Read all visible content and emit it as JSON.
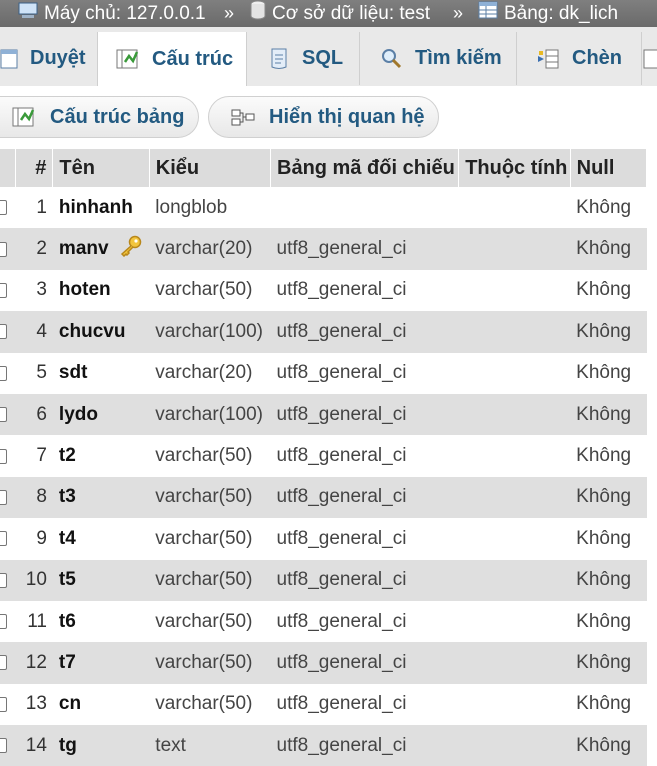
{
  "breadcrumb": {
    "server": "Máy chủ: 127.0.0.1",
    "database": "Cơ sở dữ liệu: test",
    "table": "Bảng: dk_lich",
    "separator": "»"
  },
  "tabs": [
    {
      "label": "Duyệt",
      "icon": "browse-icon"
    },
    {
      "label": "Cấu trúc",
      "icon": "structure-icon",
      "active": true
    },
    {
      "label": "SQL",
      "icon": "sql-icon"
    },
    {
      "label": "Tìm kiếm",
      "icon": "search-icon"
    },
    {
      "label": "Chèn",
      "icon": "insert-icon"
    }
  ],
  "subnav": {
    "structure_label": "Cấu trúc bảng",
    "relation_label": "Hiển thị quan hệ"
  },
  "table": {
    "headers": {
      "num": "#",
      "name": "Tên",
      "type": "Kiểu",
      "collation": "Bảng mã đối chiếu",
      "attributes": "Thuộc tính",
      "null": "Null"
    },
    "rows": [
      {
        "num": "1",
        "name": "hinhanh",
        "type": "longblob",
        "collation": "",
        "null": "Không"
      },
      {
        "num": "2",
        "name": "manv",
        "type": "varchar(20)",
        "collation": "utf8_general_ci",
        "null": "Không",
        "primary_key": true
      },
      {
        "num": "3",
        "name": "hoten",
        "type": "varchar(50)",
        "collation": "utf8_general_ci",
        "null": "Không"
      },
      {
        "num": "4",
        "name": "chucvu",
        "type": "varchar(100)",
        "collation": "utf8_general_ci",
        "null": "Không"
      },
      {
        "num": "5",
        "name": "sdt",
        "type": "varchar(20)",
        "collation": "utf8_general_ci",
        "null": "Không"
      },
      {
        "num": "6",
        "name": "lydo",
        "type": "varchar(100)",
        "collation": "utf8_general_ci",
        "null": "Không"
      },
      {
        "num": "7",
        "name": "t2",
        "type": "varchar(50)",
        "collation": "utf8_general_ci",
        "null": "Không"
      },
      {
        "num": "8",
        "name": "t3",
        "type": "varchar(50)",
        "collation": "utf8_general_ci",
        "null": "Không"
      },
      {
        "num": "9",
        "name": "t4",
        "type": "varchar(50)",
        "collation": "utf8_general_ci",
        "null": "Không"
      },
      {
        "num": "10",
        "name": "t5",
        "type": "varchar(50)",
        "collation": "utf8_general_ci",
        "null": "Không"
      },
      {
        "num": "11",
        "name": "t6",
        "type": "varchar(50)",
        "collation": "utf8_general_ci",
        "null": "Không"
      },
      {
        "num": "12",
        "name": "t7",
        "type": "varchar(50)",
        "collation": "utf8_general_ci",
        "null": "Không"
      },
      {
        "num": "13",
        "name": "cn",
        "type": "varchar(50)",
        "collation": "utf8_general_ci",
        "null": "Không"
      },
      {
        "num": "14",
        "name": "tg",
        "type": "text",
        "collation": "utf8_general_ci",
        "null": "Không"
      }
    ]
  },
  "colors": {
    "link": "#235a81",
    "header_bar": "#7f7f7f",
    "row_alt": "#dfdfdf",
    "key_icon": "#e8b923"
  }
}
